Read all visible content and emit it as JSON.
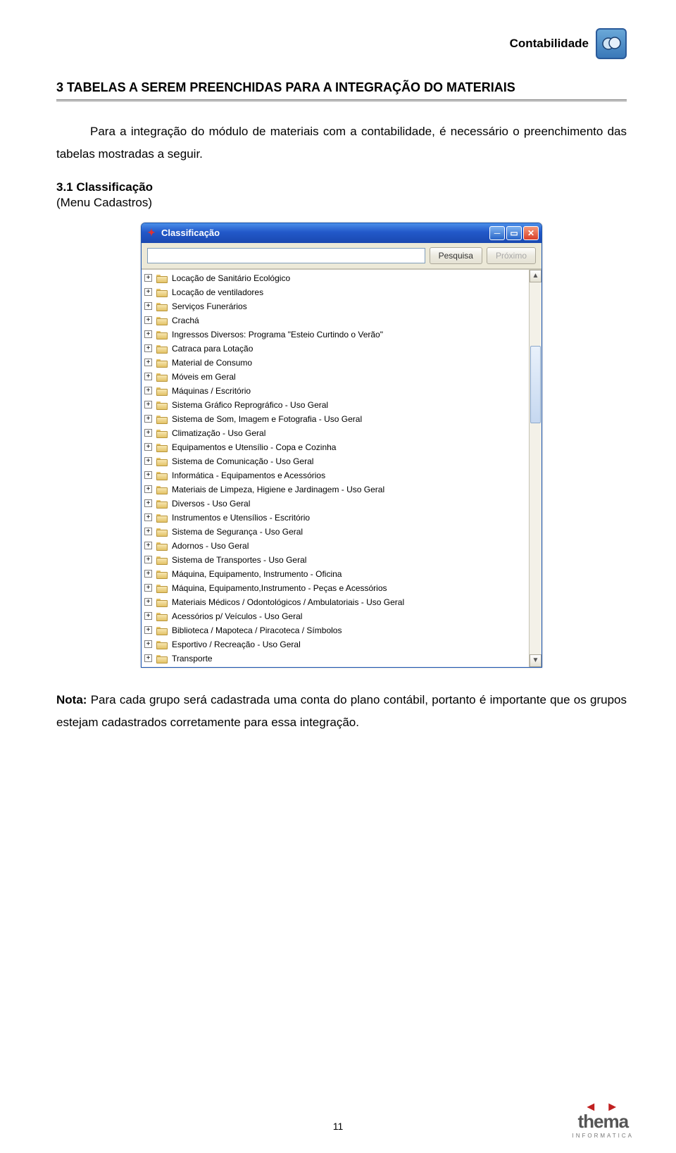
{
  "header": {
    "label": "Contabilidade"
  },
  "section": {
    "heading": "3 TABELAS A SEREM PREENCHIDAS PARA A INTEGRAÇÃO DO MATERIAIS",
    "intro": "Para a integração do módulo de materiais com a contabilidade, é necessário o preenchimento das tabelas mostradas a seguir.",
    "sub_heading": "3.1 Classificação",
    "sub_line": "(Menu Cadastros)"
  },
  "window": {
    "title": "Classificação",
    "search_placeholder": "",
    "buttons": {
      "search": "Pesquisa",
      "next": "Próximo"
    },
    "tree": [
      "Locação de Sanitário Ecológico",
      "Locação de ventiladores",
      "Serviços Funerários",
      "Crachá",
      "Ingressos Diversos: Programa \"Esteio Curtindo o Verão\"",
      "Catraca para Lotação",
      "Material de Consumo",
      "Móveis em Geral",
      "Máquinas / Escritório",
      "Sistema Gráfico Reprográfico - Uso Geral",
      "Sistema de Som, Imagem e Fotografia - Uso Geral",
      "Climatização - Uso Geral",
      "Equipamentos e Utensílio - Copa e Cozinha",
      "Sistema de Comunicação - Uso Geral",
      "Informática - Equipamentos e Acessórios",
      "Materiais de Limpeza, Higiene e Jardinagem  - Uso Geral",
      "Diversos - Uso Geral",
      "Instrumentos e Utensílios - Escritório",
      "Sistema de Segurança - Uso Geral",
      "Adornos - Uso Geral",
      "Sistema de Transportes - Uso Geral",
      "Máquina, Equipamento, Instrumento - Oficina",
      "Máquina, Equipamento,Instrumento - Peças e Acessórios",
      "Materiais Médicos / Odontológicos / Ambulatoriais - Uso Geral",
      "Acessórios p/ Veículos - Uso Geral",
      "Biblioteca / Mapoteca / Piracoteca / Símbolos",
      "Esportivo / Recreação - Uso Geral",
      "Transporte"
    ]
  },
  "note": {
    "label": "Nota:",
    "text": " Para cada grupo será cadastrada uma conta do plano contábil, portanto é importante que os grupos estejam cadastrados corretamente para essa integração."
  },
  "footer": {
    "page_number": "11",
    "brand": "thema",
    "brand_sub": "INFORMATICA"
  }
}
